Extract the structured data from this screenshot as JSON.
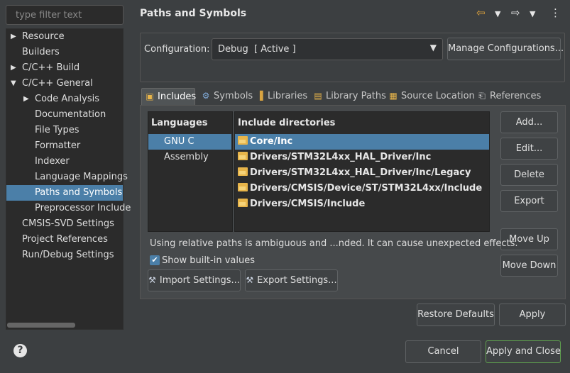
{
  "filter": {
    "placeholder": "type filter text"
  },
  "tree": {
    "items": [
      {
        "label": "Resource",
        "indent": 0,
        "expander": "right",
        "selected": false
      },
      {
        "label": "Builders",
        "indent": 0,
        "expander": "",
        "selected": false
      },
      {
        "label": "C/C++ Build",
        "indent": 0,
        "expander": "right",
        "selected": false
      },
      {
        "label": "C/C++ General",
        "indent": 0,
        "expander": "down",
        "selected": false
      },
      {
        "label": "Code Analysis",
        "indent": 1,
        "expander": "right",
        "selected": false
      },
      {
        "label": "Documentation",
        "indent": 1,
        "expander": "",
        "selected": false
      },
      {
        "label": "File Types",
        "indent": 1,
        "expander": "",
        "selected": false
      },
      {
        "label": "Formatter",
        "indent": 1,
        "expander": "",
        "selected": false
      },
      {
        "label": "Indexer",
        "indent": 1,
        "expander": "",
        "selected": false
      },
      {
        "label": "Language Mappings",
        "indent": 1,
        "expander": "",
        "selected": false
      },
      {
        "label": "Paths and Symbols",
        "indent": 1,
        "expander": "",
        "selected": true
      },
      {
        "label": "Preprocessor Include",
        "indent": 1,
        "expander": "",
        "selected": false
      },
      {
        "label": "CMSIS-SVD Settings",
        "indent": 0,
        "expander": "",
        "selected": false
      },
      {
        "label": "Project References",
        "indent": 0,
        "expander": "",
        "selected": false
      },
      {
        "label": "Run/Debug Settings",
        "indent": 0,
        "expander": "",
        "selected": false
      }
    ]
  },
  "header": {
    "title": "Paths and Symbols",
    "icons": [
      "back-arrow-icon",
      "back-menu-icon",
      "forward-arrow-icon",
      "forward-menu-icon",
      "more-icon"
    ]
  },
  "config": {
    "label": "Configuration:",
    "value": "Debug  [ Active ]",
    "manage_label": "Manage Configurations..."
  },
  "tabs": [
    {
      "label": "Includes",
      "icon": "includes-icon",
      "active": true
    },
    {
      "label": "Symbols",
      "icon": "symbols-icon",
      "active": false
    },
    {
      "label": "Libraries",
      "icon": "libraries-icon",
      "active": false
    },
    {
      "label": "Library Paths",
      "icon": "library-paths-icon",
      "active": false
    },
    {
      "label": "Source Location",
      "icon": "source-location-icon",
      "active": false
    },
    {
      "label": "References",
      "icon": "references-icon",
      "active": false
    }
  ],
  "languages": {
    "header": "Languages",
    "items": [
      {
        "label": "GNU C",
        "selected": true
      },
      {
        "label": "Assembly",
        "selected": false
      }
    ]
  },
  "includes": {
    "header": "Include directories",
    "items": [
      {
        "label": "Core/Inc",
        "selected": true
      },
      {
        "label": "Drivers/STM32L4xx_HAL_Driver/Inc",
        "selected": false
      },
      {
        "label": "Drivers/STM32L4xx_HAL_Driver/Inc/Legacy",
        "selected": false
      },
      {
        "label": "Drivers/CMSIS/Device/ST/STM32L4xx/Include",
        "selected": false
      },
      {
        "label": "Drivers/CMSIS/Include",
        "selected": false
      }
    ]
  },
  "side_buttons": {
    "add": "Add...",
    "edit": "Edit...",
    "delete": "Delete",
    "export": "Export",
    "move_up": "Move Up",
    "move_down": "Move Down"
  },
  "warning": "Using relative paths is ambiguous and ...nded. It can cause unexpected effects.",
  "show_builtin": {
    "label": "Show built-in values",
    "checked": true
  },
  "import_settings": "Import Settings...",
  "export_settings": "Export Settings...",
  "restore_defaults": "Restore Defaults",
  "apply": "Apply",
  "cancel": "Cancel",
  "apply_close": "Apply and Close",
  "colors": {
    "selection": "#4b7fa8",
    "background": "#3c3f41",
    "list_bg": "#2b2b2b",
    "accent_green": "#5e9e4e"
  }
}
